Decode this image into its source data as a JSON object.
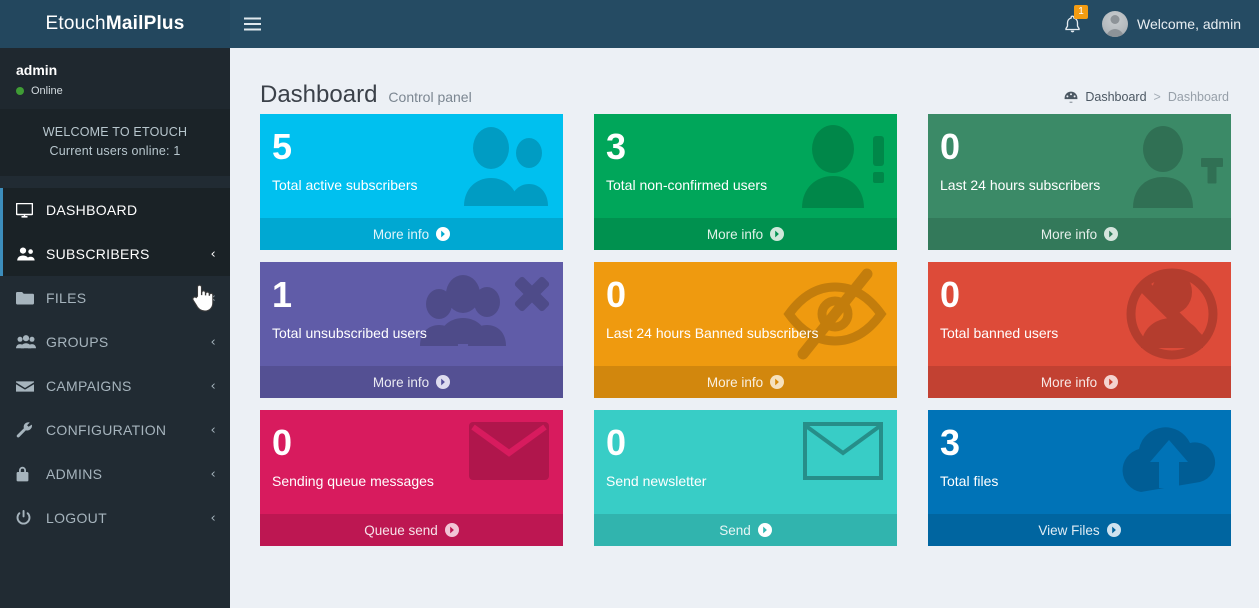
{
  "brand": {
    "name_light": "Etouch ",
    "name_bold": "MailPlus"
  },
  "topbar": {
    "hamburger_icon": "bars-icon",
    "notifications": {
      "icon": "bell-icon",
      "count": "1",
      "badge_color": "#f39c12"
    },
    "user": {
      "avatar_icon": "user-avatar",
      "greeting": "Welcome, admin"
    }
  },
  "sidebar": {
    "user_panel": {
      "name": "admin",
      "status": "Online",
      "status_color": "#3f9c35"
    },
    "welcome_box": {
      "line1": "WELCOME TO ETOUCH",
      "line2": "Current users online: 1"
    },
    "items": [
      {
        "label": "DASHBOARD",
        "icon": "desktop-icon",
        "arrow": "",
        "state": "active"
      },
      {
        "label": "SUBSCRIBERS",
        "icon": "users-icon",
        "arrow": "‹",
        "state": "hovered"
      },
      {
        "label": "FILES",
        "icon": "folder-icon",
        "arrow": "‹",
        "state": ""
      },
      {
        "label": "GROUPS",
        "icon": "group-icon",
        "arrow": "‹",
        "state": ""
      },
      {
        "label": "CAMPAIGNS",
        "icon": "envelope-icon",
        "arrow": "‹",
        "state": ""
      },
      {
        "label": "CONFIGURATION",
        "icon": "wrench-icon",
        "arrow": "‹",
        "state": ""
      },
      {
        "label": "ADMINS",
        "icon": "lock-icon",
        "arrow": "‹",
        "state": ""
      },
      {
        "label": "LOGOUT",
        "icon": "power-icon",
        "arrow": "‹",
        "state": ""
      }
    ]
  },
  "main": {
    "title": "Dashboard",
    "subtitle": "Control panel",
    "breadcrumb": {
      "icon": "dashboard-icon",
      "home": "Dashboard",
      "separator": ">",
      "current": "Dashboard"
    }
  },
  "cards": [
    {
      "number": "5",
      "label": "Total active subscribers",
      "footer": "More info",
      "color": "#00c0ef",
      "icon": "users-two-icon"
    },
    {
      "number": "3",
      "label": "Total non-confirmed users",
      "footer": "More info",
      "color": "#00a65a",
      "icon": "user-exclamation-icon"
    },
    {
      "number": "0",
      "label": "Last 24 hours subscribers",
      "footer": "More info",
      "color": "#3b8a67",
      "icon": "user-plus-icon"
    },
    {
      "number": "1",
      "label": "Total unsubscribed users",
      "footer": "More info",
      "color": "#605ca8",
      "icon": "users-times-icon"
    },
    {
      "number": "0",
      "label": "Last 24 hours Banned subscribers",
      "footer": "More info",
      "color": "#ef9a0f",
      "icon": "eye-slash-icon"
    },
    {
      "number": "0",
      "label": "Total banned users",
      "footer": "More info",
      "color": "#dd4b39",
      "icon": "user-ban-icon"
    },
    {
      "number": "0",
      "label": "Sending queue messages",
      "footer": "Queue send",
      "color": "#d81b5e",
      "icon": "envelope-solid-icon"
    },
    {
      "number": "0",
      "label": "Send newsletter",
      "footer": "Send",
      "color": "#38cdc6",
      "icon": "envelope-outline-icon"
    },
    {
      "number": "3",
      "label": "Total files",
      "footer": "View Files",
      "color": "#0073b7",
      "icon": "cloud-upload-icon"
    }
  ],
  "cursor": {
    "icon": "pointer-hand-cursor"
  }
}
